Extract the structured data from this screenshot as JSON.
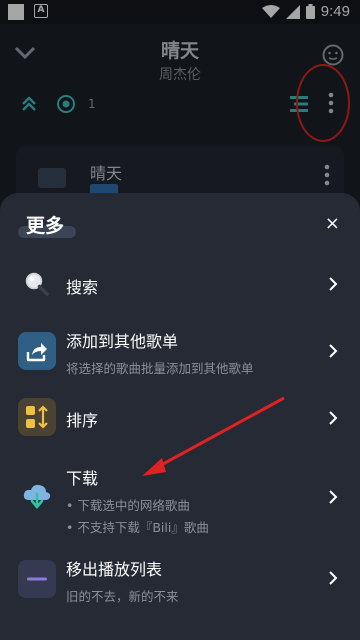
{
  "status": {
    "time": "9:49"
  },
  "player": {
    "song_title": "晴天",
    "artist": "周杰伦",
    "queue_count": "1",
    "card_title": "晴天"
  },
  "sheet": {
    "title": "更多",
    "close": "×",
    "items": [
      {
        "label": "搜索",
        "icon": "search-icon"
      },
      {
        "label": "添加到其他歌单",
        "sub": "将选择的歌曲批量添加到其他歌单",
        "icon": "share-icon"
      },
      {
        "label": "排序",
        "icon": "sort-icon"
      },
      {
        "label": "下载",
        "sub": "• 下载选中的网络歌曲",
        "sub2": "• 不支持下载『Bili』歌曲",
        "icon": "cloud-download-icon"
      },
      {
        "label": "移出播放列表",
        "sub": "旧的不去，新的不来",
        "icon": "remove-icon"
      }
    ]
  },
  "colors": {
    "accent": "#3fbfbf",
    "annotation_red": "#e02222",
    "sort_icon_bg": "#f0c040"
  }
}
